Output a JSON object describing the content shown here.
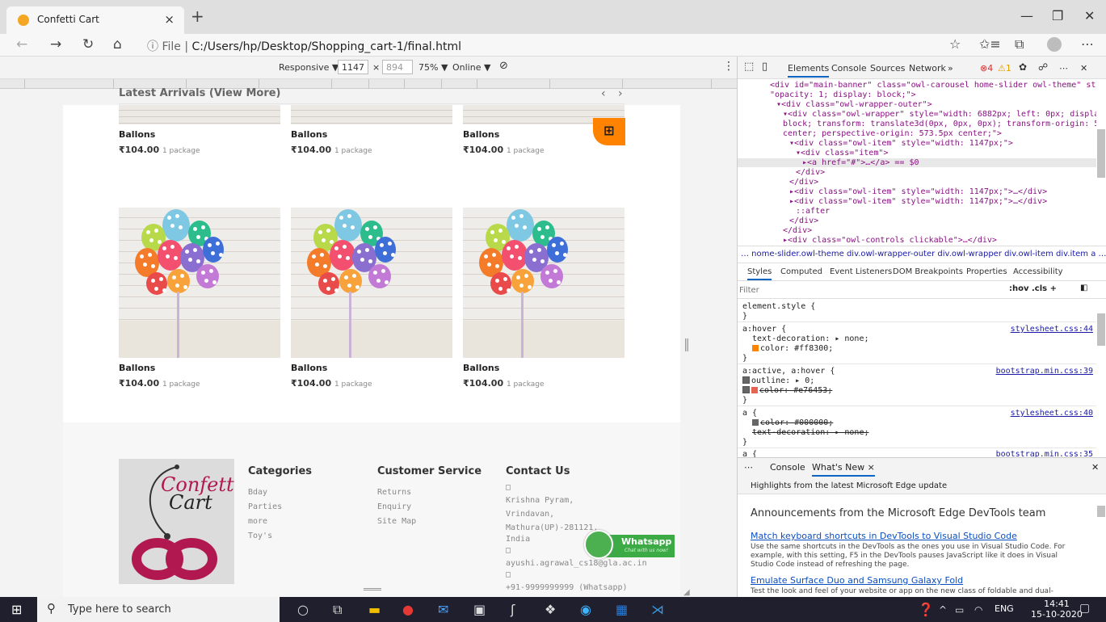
{
  "browser": {
    "tab_title": "Confetti Cart",
    "tab_close": "×",
    "new_tab": "+",
    "minimize": "—",
    "maximize": "❐",
    "close": "✕",
    "back": "←",
    "forward": "→",
    "refresh": "↻",
    "home": "⌂",
    "url_prefix": "ⓘ File  |",
    "url": "C:/Users/hp/Desktop/Shopping_cart-1/final.html",
    "star": "☆",
    "favorites": "✩≡",
    "collections": "⧉",
    "more": "⋯"
  },
  "responsive_bar": {
    "device": "Responsive ▼",
    "width": "1147",
    "x": "×",
    "height": "894",
    "zoom": "75% ▼",
    "throttle": "Online ▼",
    "rotate": "⊘",
    "options": "⋮"
  },
  "top_products": [
    {
      "name": "Ballons",
      "price": "₹104.00",
      "unit": "1 package"
    },
    {
      "name": "Ballons",
      "price": "₹104.00",
      "unit": "1 package"
    },
    {
      "name": "Ballons",
      "price": "₹104.00",
      "unit": "1 package"
    }
  ],
  "latest": {
    "title": "Latest Arrivals (View More)",
    "prev": "‹",
    "next": "›",
    "cart_icon": "🛒",
    "products": [
      {
        "name": "Ballons",
        "price": "₹104.00",
        "unit": "1 package"
      },
      {
        "name": "Ballons",
        "price": "₹104.00",
        "unit": "1 package"
      },
      {
        "name": "Ballons",
        "price": "₹104.00",
        "unit": "1 package"
      }
    ]
  },
  "footer": {
    "logo_line1": "Confetti",
    "logo_line2": "Cart",
    "categories": {
      "title": "Categories",
      "items": [
        "Bday",
        "Parties",
        "more",
        "Toy's"
      ]
    },
    "service": {
      "title": "Customer Service",
      "items": [
        "Returns",
        "Enquiry",
        "Site Map"
      ]
    },
    "contact": {
      "title": "Contact Us",
      "lines": [
        "□",
        "Krishna Pyram,",
        "Vrindavan,",
        "Mathura(UP)-281121,",
        "India",
        "□",
        "ayushi.agrawal_cs18@gla.ac.in",
        "□",
        "+91-9999999999 (Whatsapp)"
      ]
    },
    "whatsapp": "Whatsapp",
    "whatsapp_sub": "Chat with us now!"
  },
  "devtools": {
    "tabs": [
      "Elements",
      "Console",
      "Sources",
      "Network",
      "»"
    ],
    "errors": "⊗4",
    "warnings": "⚠1",
    "dom_lines": [
      {
        "indent": 0,
        "text": "<div id=\"main-banner\" class=\"owl-carousel home-slider owl-theme\" style="
      },
      {
        "indent": 0,
        "text": "\"opacity: 1; display: block;\">"
      },
      {
        "indent": 1,
        "text": "▾<div class=\"owl-wrapper-outer\">"
      },
      {
        "indent": 2,
        "text": "▾<div class=\"owl-wrapper\" style=\"width: 6882px; left: 0px; display:"
      },
      {
        "indent": 2,
        "text": "block; transform: translate3d(0px, 0px, 0px); transform-origin: 573.5px"
      },
      {
        "indent": 2,
        "text": "center; perspective-origin: 573.5px center;\">"
      },
      {
        "indent": 3,
        "text": "▾<div class=\"owl-item\" style=\"width: 1147px;\">"
      },
      {
        "indent": 4,
        "text": "▾<div class=\"item\">"
      },
      {
        "indent": 5,
        "text": "▸<a href=\"#\">…</a> == $0"
      },
      {
        "indent": 4,
        "text": "</div>"
      },
      {
        "indent": 3,
        "text": "</div>"
      },
      {
        "indent": 3,
        "text": "▸<div class=\"owl-item\" style=\"width: 1147px;\">…</div>"
      },
      {
        "indent": 3,
        "text": "▸<div class=\"owl-item\" style=\"width: 1147px;\">…</div>"
      },
      {
        "indent": 4,
        "text": "::after"
      },
      {
        "indent": 3,
        "text": "</div>"
      },
      {
        "indent": 2,
        "text": "</div>"
      },
      {
        "indent": 2,
        "text": "▸<div class=\"owl-controls clickable\">…</div>"
      }
    ],
    "breadcrumbs": "…  nome-slider.owl-theme   div.owl-wrapper-outer   div.owl-wrapper   div.owl-item   div.item   a   …",
    "style_tabs": [
      "Styles",
      "Computed",
      "Event Listeners",
      "DOM Breakpoints",
      "Properties",
      "Accessibility"
    ],
    "filter": "Filter",
    "filter_tools": ":hov  .cls  +",
    "rules": [
      {
        "sel": "element.style {",
        "src": ""
      },
      {
        "sel": "a:hover {",
        "src": "stylesheet.css:44",
        "props": [
          "text-decoration: ▸ none;",
          "color: #ff8300;"
        ]
      },
      {
        "sel": "a:active, a:hover {",
        "src": "bootstrap.min.css:39",
        "props": [
          "outline: ▸ 0;",
          "color: #e76453;"
        ]
      },
      {
        "sel": "a {",
        "src": "stylesheet.css:40",
        "props": [
          "color: #000000;",
          "text-decoration: ▸ none;"
        ]
      },
      {
        "sel": "a {",
        "src": "bootstrap.min.css:35"
      }
    ],
    "hover_color": "#ff8300",
    "active_color": "#e76453",
    "drawer_tabs": [
      "⋯",
      "Console",
      "What's New ×"
    ],
    "drawer_close": "✕",
    "highlights": "Highlights from the latest Microsoft Edge update",
    "announcement_title": "Announcements from the Microsoft Edge DevTools team",
    "link1": "Match keyboard shortcuts in DevTools to Visual Studio Code",
    "text1": "Use the same shortcuts in the DevTools as the ones you use in Visual Studio Code. For example, with this setting, F5 in the DevTools pauses JavaScript like it does in Visual Studio Code instead of refreshing the page.",
    "link2": "Emulate Surface Duo and Samsung Galaxy Fold",
    "text2": "Test the look and feel of your website or app on the new class of foldable and dual-"
  },
  "taskbar": {
    "search_placeholder": "Type here to search",
    "lang": "ENG",
    "time": "14:41",
    "date": "15-10-2020"
  },
  "colors": {
    "accent_orange": "#ff8300",
    "whatsapp_green": "#3cab45",
    "logo_magenta": "#b0184f"
  }
}
